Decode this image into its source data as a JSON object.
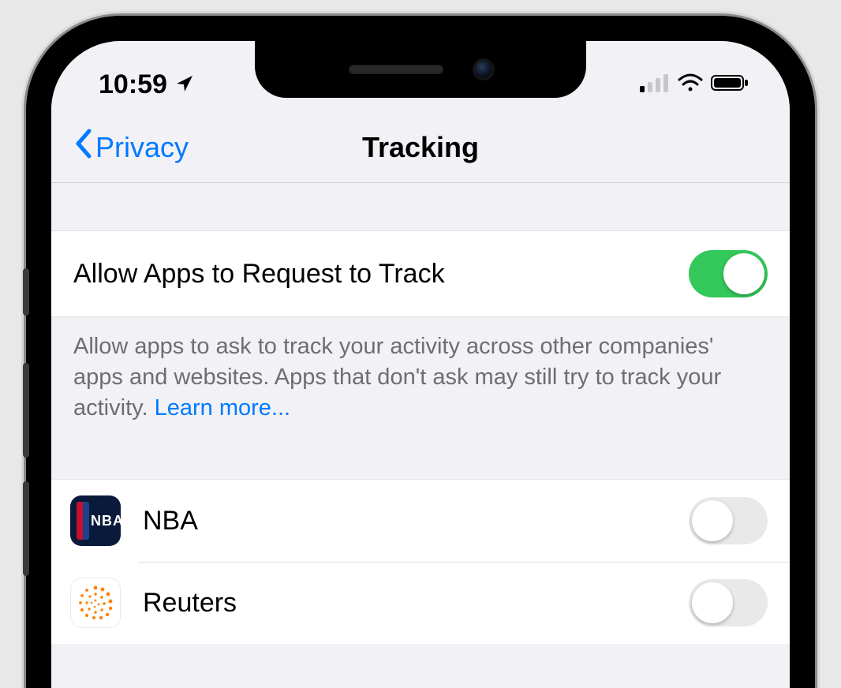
{
  "status": {
    "time": "10:59",
    "location_icon": "location-arrow",
    "signal_bars": 1,
    "wifi": true,
    "battery": "full"
  },
  "nav": {
    "back_label": "Privacy",
    "title": "Tracking"
  },
  "settings": {
    "allow_label": "Allow Apps to Request to Track",
    "allow_on": true,
    "footer_text": "Allow apps to ask to track your activity across other companies' apps and websites. Apps that don't ask may still try to track your activity. ",
    "learn_more": "Learn more..."
  },
  "apps": [
    {
      "name": "NBA",
      "icon": "nba",
      "tracking_on": false
    },
    {
      "name": "Reuters",
      "icon": "reuters",
      "tracking_on": false
    }
  ]
}
